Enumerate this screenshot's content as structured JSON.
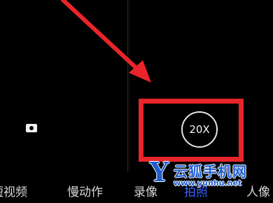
{
  "zoom": {
    "label": "20X"
  },
  "modes": [
    {
      "label": "短视频"
    },
    {
      "label": "慢动作"
    },
    {
      "label": "录像"
    },
    {
      "label": "拍照",
      "active": true
    },
    {
      "label": "人像"
    }
  ],
  "watermark": {
    "mark": "Y",
    "title": "云狐手机网",
    "url": "www.yunhu.net"
  },
  "colors": {
    "highlight": "#e8252b",
    "arrow": "#e8252b",
    "active_mode": "#3a62ff",
    "watermark_blue": "#1e5fd0"
  },
  "icons": {
    "camera_flip": "camera-flip-icon",
    "arrow": "red-arrow-annotation"
  }
}
